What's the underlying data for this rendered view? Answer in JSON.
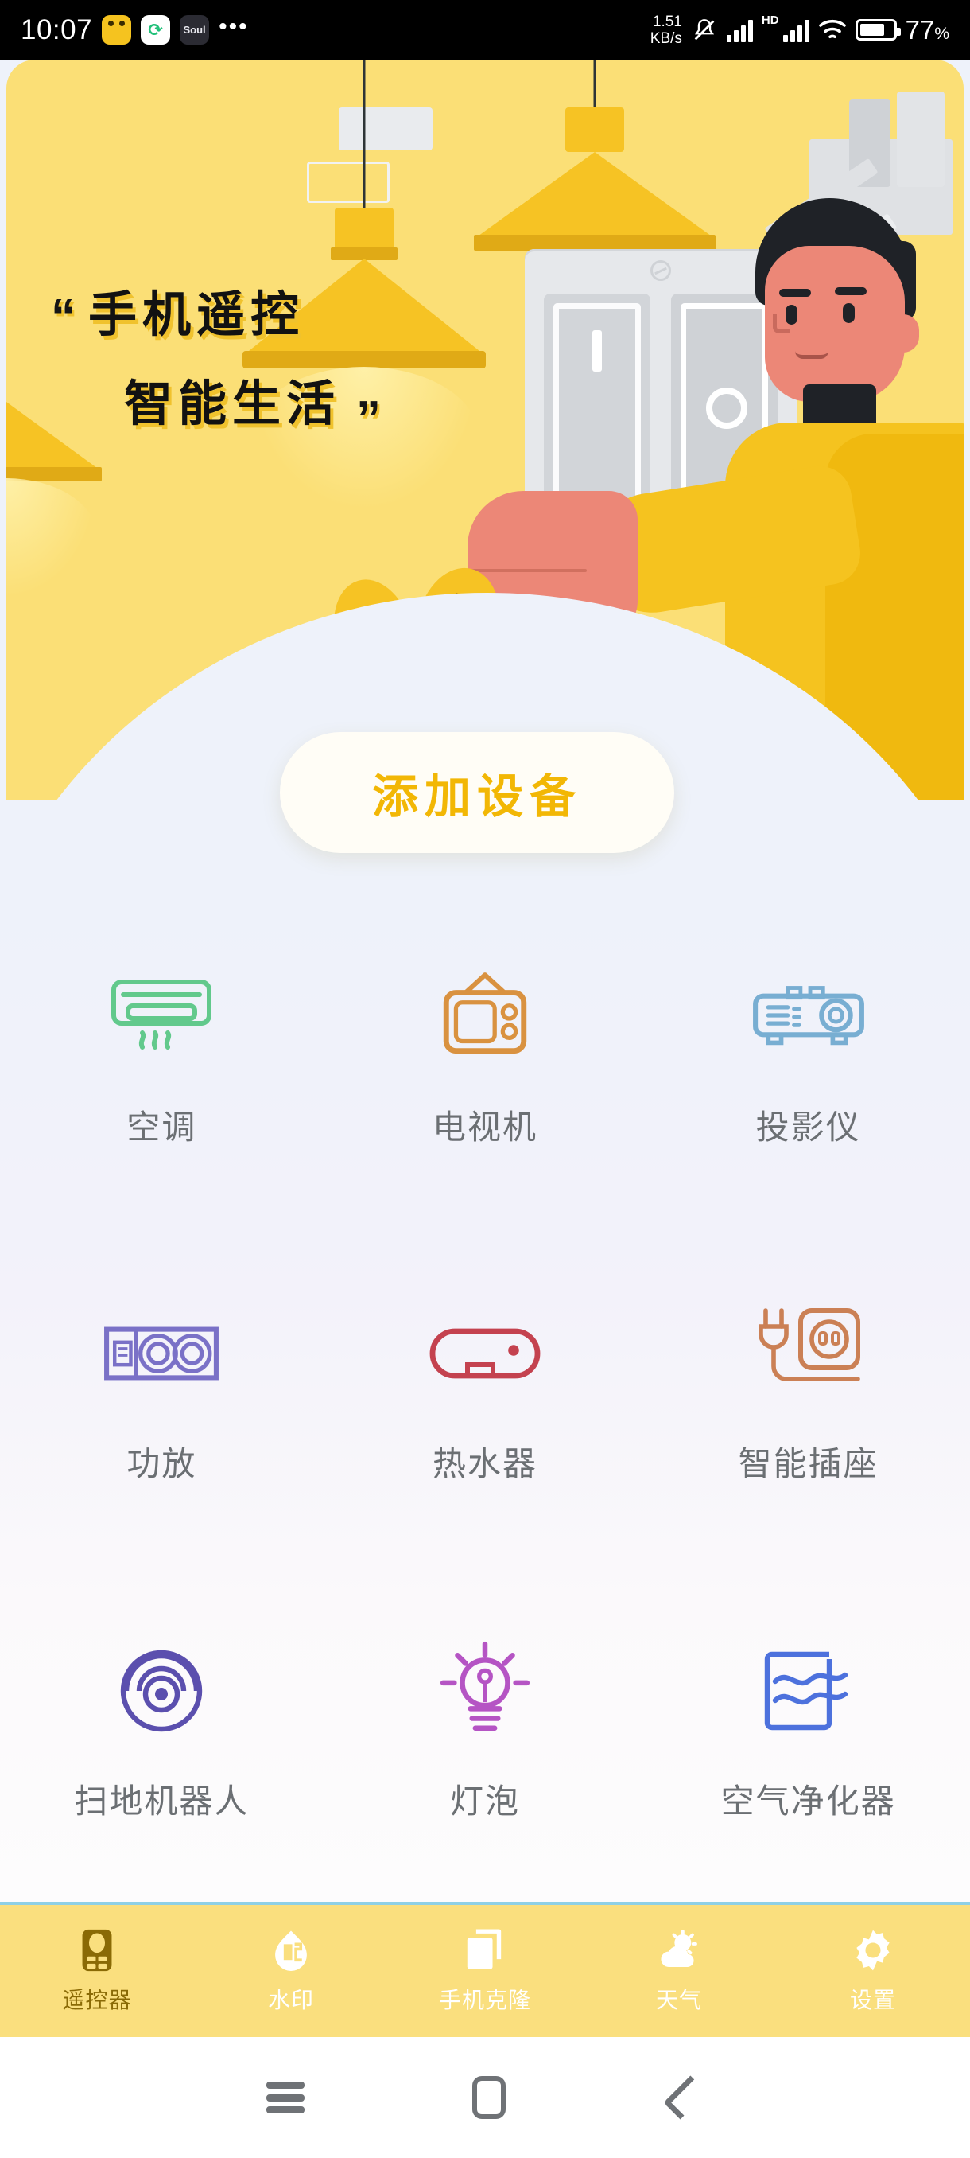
{
  "status_bar": {
    "time": "10:07",
    "app_icons": [
      "yellow-app-icon",
      "green-camera-icon",
      "soul-app-icon"
    ],
    "overflow": "•••",
    "net_rate_value": "1.51",
    "net_rate_unit": "KB/s",
    "mute_icon": "mute-bell-icon",
    "signal_1": "signal-bars-icon",
    "hd_label": "HD",
    "signal_2": "signal-bars-icon",
    "wifi_icon": "wifi-icon",
    "battery_icon": "battery-icon",
    "battery_percent": "77",
    "percent_symbol": "%"
  },
  "hero": {
    "headline_line1": "手机遥控",
    "headline_line2": "智能生活",
    "quote_open": "“",
    "quote_close": "”",
    "background_color": "#fbdf76"
  },
  "add_button": {
    "label": "添加设备",
    "text_color": "#f2b705",
    "background_color": "#fffdf6"
  },
  "devices": [
    {
      "label": "空调",
      "icon": "air-conditioner-icon",
      "color": "#62c98c"
    },
    {
      "label": "电视机",
      "icon": "television-icon",
      "color": "#d99240"
    },
    {
      "label": "投影仪",
      "icon": "projector-icon",
      "color": "#78aed2"
    },
    {
      "label": "功放",
      "icon": "amplifier-icon",
      "color": "#7a71c7"
    },
    {
      "label": "热水器",
      "icon": "water-heater-icon",
      "color": "#c4424f"
    },
    {
      "label": "智能插座",
      "icon": "smart-plug-icon",
      "color": "#cb8055"
    },
    {
      "label": "扫地机器人",
      "icon": "robot-vacuum-icon",
      "color": "#5b4fae"
    },
    {
      "label": "灯泡",
      "icon": "light-bulb-icon",
      "color": "#b554c4"
    },
    {
      "label": "空气净化器",
      "icon": "air-purifier-icon",
      "color": "#4d71dd"
    }
  ],
  "tabs": [
    {
      "label": "遥控器",
      "icon": "remote-control-icon",
      "active": true
    },
    {
      "label": "水印",
      "icon": "watermark-icon",
      "active": false
    },
    {
      "label": "手机克隆",
      "icon": "phone-clone-icon",
      "active": false
    },
    {
      "label": "天气",
      "icon": "weather-icon",
      "active": false
    },
    {
      "label": "设置",
      "icon": "settings-gear-icon",
      "active": false
    }
  ],
  "nav_bar": {
    "recents": "recents-icon",
    "home": "home-icon",
    "back": "back-icon"
  }
}
